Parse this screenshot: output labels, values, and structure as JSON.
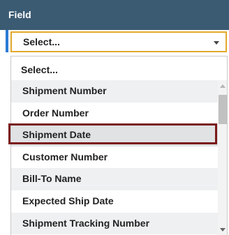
{
  "header": {
    "title": "Field"
  },
  "select": {
    "value": "Select..."
  },
  "list": {
    "first_option": "Select...",
    "options": [
      "Shipment Number",
      "Order Number",
      "Shipment Date",
      "Customer Number",
      "Bill-To Name",
      "Expected Ship Date",
      "Shipment Tracking Number"
    ],
    "highlighted": "Shipment Date"
  },
  "colors": {
    "header_bg": "#3b5b73",
    "accent_bar": "#2a7bd4",
    "select_border": "#e3a829",
    "highlight_border": "#7a1a1a"
  }
}
